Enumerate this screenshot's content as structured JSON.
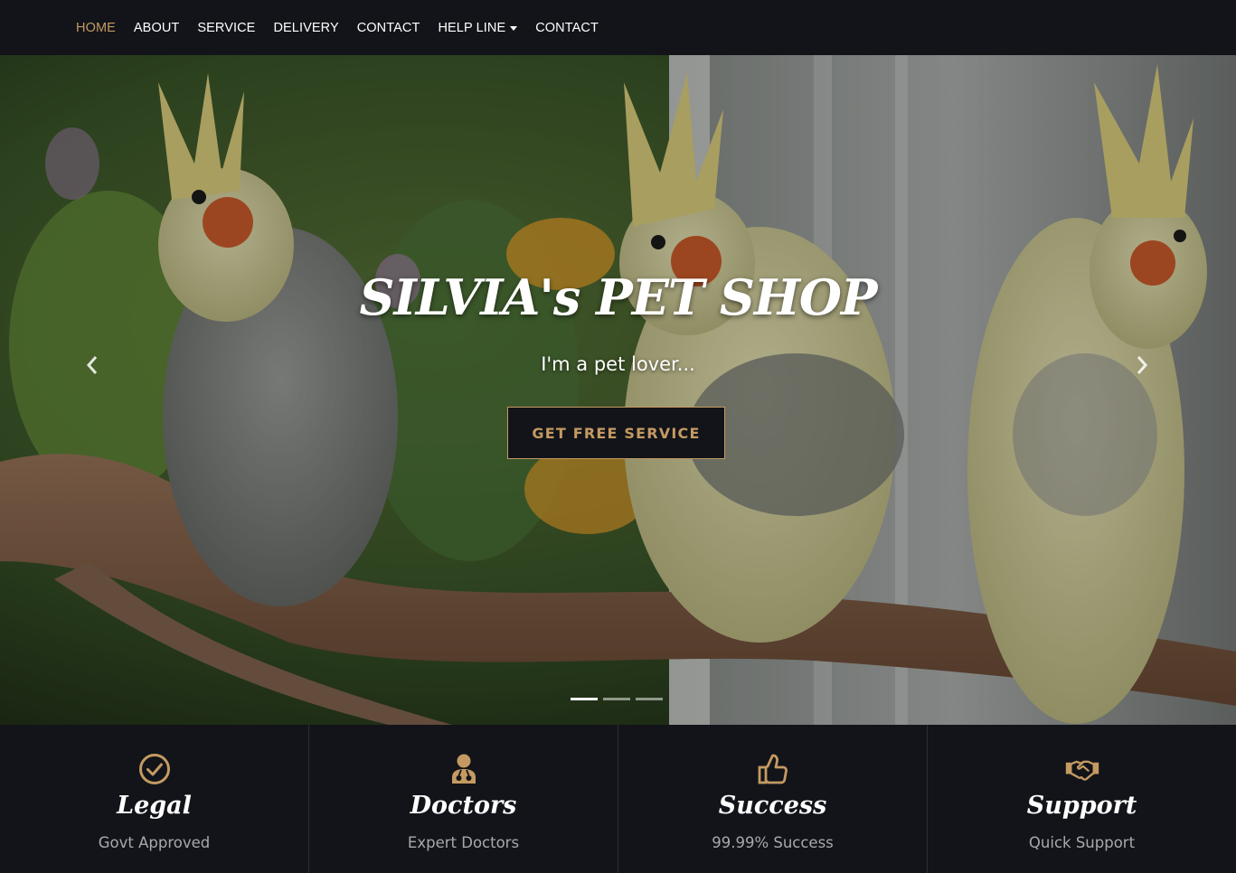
{
  "nav": {
    "items": [
      {
        "label": "HOME",
        "active": true
      },
      {
        "label": "ABOUT"
      },
      {
        "label": "SERVICE"
      },
      {
        "label": "DELIVERY"
      },
      {
        "label": "CONTACT"
      },
      {
        "label": "HELP LINE",
        "dropdown": true
      },
      {
        "label": "CONTACT"
      }
    ]
  },
  "hero": {
    "title": "SILVIA's PET SHOP",
    "subtitle": "I'm a pet lover...",
    "button_label": "GET FREE SERVICE",
    "slide_count": 3,
    "active_slide": 1
  },
  "features": [
    {
      "icon": "check-circle-icon",
      "title": "Legal",
      "subtitle": "Govt Approved"
    },
    {
      "icon": "doctor-icon",
      "title": "Doctors",
      "subtitle": "Expert Doctors"
    },
    {
      "icon": "thumbs-up-icon",
      "title": "Success",
      "subtitle": "99.99% Success"
    },
    {
      "icon": "handshake-icon",
      "title": "Support",
      "subtitle": "Quick Support"
    }
  ],
  "colors": {
    "accent": "#c49a62",
    "background": "#121419",
    "text": "#ffffff",
    "muted": "#a7a9ad"
  }
}
